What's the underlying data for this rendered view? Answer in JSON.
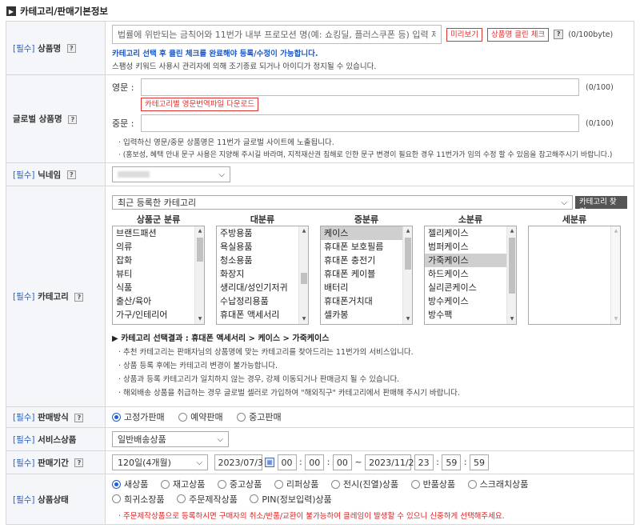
{
  "section": {
    "title": "카테고리/판매기본정보"
  },
  "product_name": {
    "label_req": "[필수]",
    "label": "상품명",
    "placeholder": "법률에 위반되는 금칙어와 11번가 내부 프로모션 명(예: 쇼킹딜, 플러스쿠폰 등) 입력 제한",
    "preview_btn": "미리보기",
    "clean_check_btn": "상품명 클린 체크",
    "byte_count": "(0/100byte)",
    "note_blue": "카테고리 선택 후 클린 체크를 완료해야 등록/수정이 가능합니다.",
    "note_spam": "스팸성 키워드 사용시 관리자에 의해 조기종료 되거나 아이디가 정지될 수 있습니다."
  },
  "global_name": {
    "label": "글로벌 상품명",
    "en_label": "영문 :",
    "en_count": "(0/100)",
    "download_btn": "카테고리별 영문번역파일 다운로드",
    "cn_label": "중문 :",
    "cn_count": "(0/100)",
    "note1": "· 입력하신 영문/중문 상품명은 11번가 글로벌 사이트에 노출됩니다.",
    "note2": "· (홍보성, 혜택 안내 문구 사용은 지양해 주시길 바라며, 지적재산권 침해로 인한 문구 변경이 필요한 경우 11번가가 임의 수정 할 수 있음을 참고해주시기 바랍니다.)"
  },
  "nickname": {
    "label_req": "[필수]",
    "label": "닉네임",
    "value": ""
  },
  "category": {
    "label_req": "[필수]",
    "label": "카테고리",
    "recent_select": "최근 등록한 카테고리",
    "find_btn": "카테고리 찾기",
    "columns": [
      {
        "head": "상품군 분류",
        "items": [
          "브랜드패션",
          "의류",
          "잡화",
          "뷰티",
          "식품",
          "출산/육아",
          "가구/인테리어"
        ],
        "selected": -1
      },
      {
        "head": "대분류",
        "items": [
          "주방용품",
          "욕실용품",
          "청소용품",
          "화장지",
          "생리대/성인기저귀",
          "수납정리용품",
          "휴대폰 액세서리"
        ],
        "selected": -1
      },
      {
        "head": "중분류",
        "items": [
          "케이스",
          "휴대폰 보호필름",
          "휴대폰 충전기",
          "휴대폰 케이블",
          "배터리",
          "휴대폰거치대",
          "셀카봉"
        ],
        "selected": 0
      },
      {
        "head": "소분류",
        "items": [
          "젤리케이스",
          "범퍼케이스",
          "가죽케이스",
          "하드케이스",
          "실리콘케이스",
          "방수케이스",
          "방수팩"
        ],
        "selected": 2
      },
      {
        "head": "세분류",
        "items": [],
        "selected": -1
      }
    ],
    "result_label": "카테고리 선택결과 :",
    "result_path": "휴대폰 액세서리 > 케이스 > 가죽케이스",
    "notes": [
      "· 추천 카테고리는 판매자님의 상품명에 맞는 카테고리를 찾아드리는 11번가의 서비스입니다.",
      "· 상품 등록 후에는 카테고리 변경이 불가능합니다.",
      "· 상품과 등록 카테고리가 일치하지 않는 경우, 강제 이동되거나 판매금지 될 수 있습니다.",
      "· 해외배송 상품을 취급하는 경우 글로벌 셀러로 가입하여 \"해외직구\" 카테고리에서 판매해 주시기 바랍니다."
    ]
  },
  "sale_method": {
    "label_req": "[필수]",
    "label": "판매방식",
    "options": [
      "고정가판매",
      "예약판매",
      "중고판매"
    ],
    "selected": 0
  },
  "service": {
    "label_req": "[필수]",
    "label": "서비스상품",
    "value": "일반배송상품"
  },
  "period": {
    "label_req": "[필수]",
    "label": "판매기간",
    "duration": "120일(4개월)",
    "start_date": "2023/07/3",
    "start_h": "00",
    "start_m": "00",
    "start_s": "00",
    "tilde": "~",
    "end_date": "2023/11/2",
    "end_h": "23",
    "end_m": "59",
    "end_s": "59"
  },
  "condition": {
    "label_req": "[필수]",
    "label": "상품상태",
    "options": [
      "새상품",
      "재고상품",
      "중고상품",
      "리퍼상품",
      "전시(진열)상품",
      "반품상품",
      "스크래치상품",
      "희귀소장품",
      "주문제작상품",
      "PIN(정보입력)상품"
    ],
    "selected": 0,
    "note": "· 주문제작상품으로 등록하시면 구매자의 취소/반품/교환이 불가능하여 클레임이 발생할 수 있으니 신중하게 선택해주세요."
  },
  "colors": {
    "accent_blue": "#1a57c5",
    "red": "#d22222",
    "label_bg": "#f4f6fa"
  },
  "icons": {
    "help": "question-icon",
    "calendar": "calendar-icon",
    "chevron": "chevron-down-icon"
  }
}
